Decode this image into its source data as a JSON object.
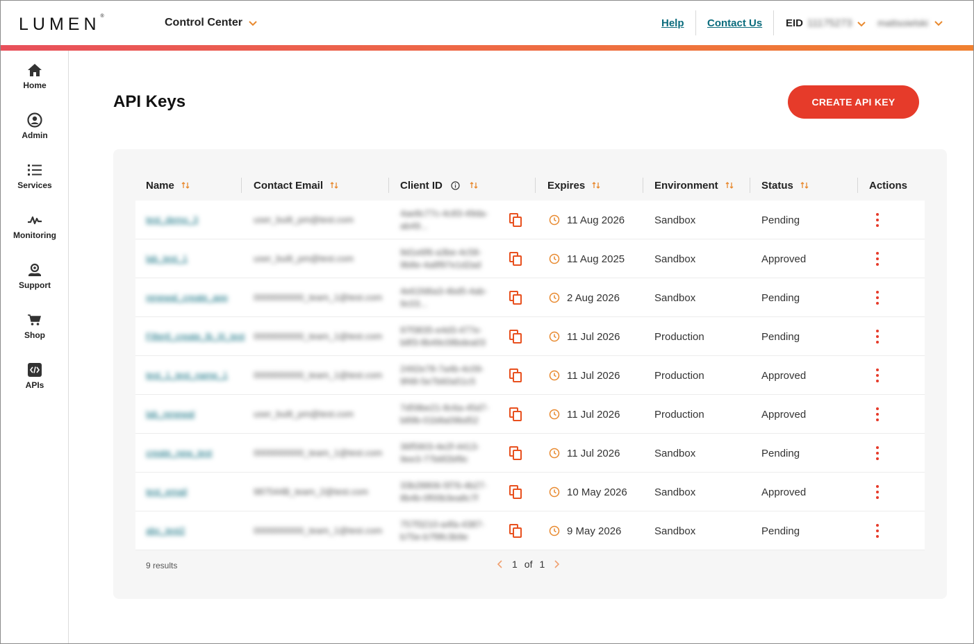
{
  "header": {
    "logo": "LUMEN",
    "logo_mark": "®",
    "app_switch": "Control Center",
    "help": "Help",
    "contact": "Contact Us",
    "eid_label": "EID",
    "eid_value": "11175273",
    "username": "mattsoielski"
  },
  "sidebar": {
    "items": [
      {
        "label": "Home",
        "icon": "home-icon"
      },
      {
        "label": "Admin",
        "icon": "user-circle-icon"
      },
      {
        "label": "Services",
        "icon": "list-icon"
      },
      {
        "label": "Monitoring",
        "icon": "pulse-icon"
      },
      {
        "label": "Support",
        "icon": "support-icon"
      },
      {
        "label": "Shop",
        "icon": "cart-icon"
      },
      {
        "label": "APIs",
        "icon": "code-icon"
      }
    ]
  },
  "page": {
    "title": "API Keys",
    "create_button": "CREATE API KEY"
  },
  "table": {
    "columns": [
      "Name",
      "Contact Email",
      "Client ID",
      "Expires",
      "Environment",
      "Status",
      "Actions"
    ],
    "rows": [
      {
        "name": "test_demo_3",
        "email": "user_built_pm@test.com",
        "client_id": "4ae8c77c-4c83-49da-ab49...",
        "expires": "11 Aug 2026",
        "environment": "Sandbox",
        "status": "Pending"
      },
      {
        "name": "lab_test_1",
        "email": "user_built_pm@test.com",
        "client_id": "9d1e6f6-a3be-4c58-9b8e-4a8f97e1d2ad",
        "expires": "11 Aug 2025",
        "environment": "Sandbox",
        "status": "Approved"
      },
      {
        "name": "renewal_create_app",
        "email": "0000000000_team_1@test.com",
        "client_id": "4e61fd6a3-4bd5-4ab-9c03...",
        "expires": "2 Aug 2026",
        "environment": "Sandbox",
        "status": "Pending"
      },
      {
        "name": "Filtertl_create_lb_III_test",
        "email": "0000000000_team_1@test.com",
        "client_id": "97f3835-e4d3-477e-b8f3-8b49c08bdea03",
        "expires": "11 Jul 2026",
        "environment": "Production",
        "status": "Pending"
      },
      {
        "name": "test_1_test_name_1",
        "email": "0000000000_team_1@test.com",
        "client_id": "2492e78-7a4b-4c09-9f48-5e7b60a51c5",
        "expires": "11 Jul 2026",
        "environment": "Production",
        "status": "Approved"
      },
      {
        "name": "lab_renewal",
        "email": "user_built_pm@test.com",
        "client_id": "7d59be21-8c6a-45d7-b89b-01b8a09bd52",
        "expires": "11 Jul 2026",
        "environment": "Production",
        "status": "Approved"
      },
      {
        "name": "create_new_test",
        "email": "0000000000_team_1@test.com",
        "client_id": "36f5903-4e2f-4413-9ee3-77b6f2bf9c",
        "expires": "11 Jul 2026",
        "environment": "Sandbox",
        "status": "Pending"
      },
      {
        "name": "test_email",
        "email": "987544B_team_2@test.com",
        "client_id": "33b28806-5f76-4b27-8b4b-0f00b3ea8c7f",
        "expires": "10 May 2026",
        "environment": "Sandbox",
        "status": "Approved"
      },
      {
        "name": "abc_test2",
        "email": "0000000000_team_1@test.com",
        "client_id": "757f3210-a4fa-4387-b75e-b7f9fc3b9e",
        "expires": "9 May 2026",
        "environment": "Sandbox",
        "status": "Pending"
      }
    ]
  },
  "footer": {
    "results": "9 results",
    "page_current": "1",
    "page_of": "of",
    "page_total": "1"
  },
  "colors": {
    "brand_red": "#e63b2a",
    "link_teal": "#0b6c7d",
    "accent_orange": "#f08030"
  }
}
